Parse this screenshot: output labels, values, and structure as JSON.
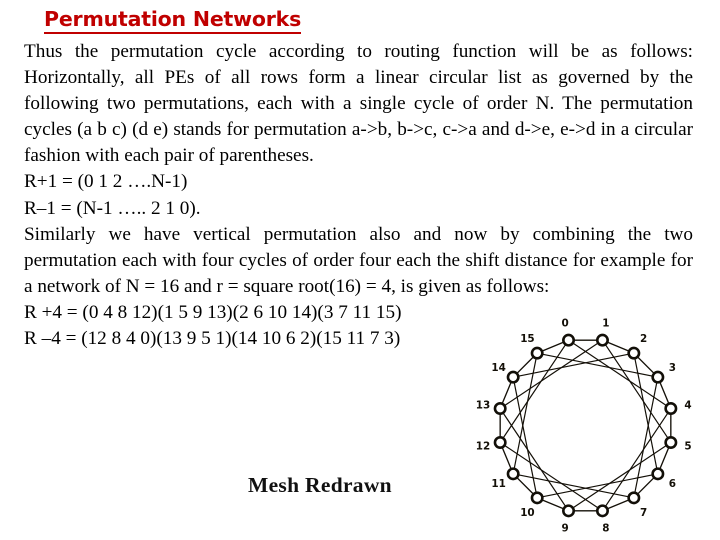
{
  "slide": {
    "title": "Permutation Networks",
    "title_color": "#c00000",
    "body_color": "#000000",
    "background": "#ffffff"
  },
  "body": {
    "paragraph_1": "Thus the permutation cycle according to routing function will be as follows: Horizontally, all PEs of all rows form a linear circular list as governed by the following two permutations, each with a single cycle of order N. The permutation cycles (a b c) (d e) stands for permutation a->b, b->c, c->a and d->e, e->d in a circular fashion with each pair of parentheses.",
    "line_r_plus_1": "R+1 = (0 1 2 ….N-1)",
    "line_r_minus_1": "R–1 = (N-1 ….. 2 1 0).",
    "paragraph_2": "Similarly we have vertical permutation also and now by combining the two permutation each with four cycles of order four each the shift distance for example for a network of N = 16 and r = square root(16) = 4, is given as follows:",
    "line_r_plus_4": "R +4 = (0 4 8 12)(1 5 9 13)(2 6 10 14)(3 7 11 15)",
    "line_r_minus_4": "R –4 = (12 8 4 0)(13 9 5 1)(14 10 6 2)(15 11 7 3)"
  },
  "figure": {
    "caption": "Mesh Redrawn",
    "node_count": 16,
    "node_labels": [
      "0",
      "1",
      "2",
      "3",
      "4",
      "5",
      "6",
      "7",
      "8",
      "9",
      "10",
      "11",
      "12",
      "13",
      "14",
      "15"
    ],
    "ring_shift": 1,
    "chord_shift": 4,
    "edge_color": "#141008",
    "node_fill": "#ffffff",
    "node_stroke": "#120f08"
  }
}
